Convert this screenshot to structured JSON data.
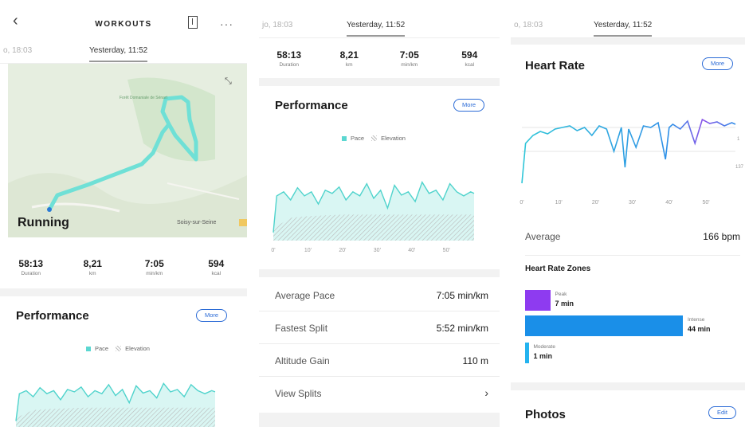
{
  "header": {
    "title": "WORKOUTS",
    "more_label": "···",
    "back_label": "‹"
  },
  "session_tabs": {
    "screen1": {
      "previous": "o, 18:03",
      "current": "Yesterday, 11:52"
    },
    "screen2": {
      "previous": "jo, 18:03",
      "current": "Yesterday, 11:52"
    },
    "screen3": {
      "previous": "o, 18:03",
      "current": "Yesterday, 11:52"
    }
  },
  "map": {
    "activity": "Running",
    "forest_label": "Forêt Domaniale de Sénart",
    "town_label": "Soisy-sur-Seine"
  },
  "stats": [
    {
      "value": "58:13",
      "label": "Duration"
    },
    {
      "value": "8,21",
      "label": "km"
    },
    {
      "value": "7:05",
      "label": "min/km"
    },
    {
      "value": "594",
      "label": "kcal"
    }
  ],
  "performance": {
    "title": "Performance",
    "more_label": "More",
    "legend": {
      "pace": "Pace",
      "elevation": "Elevation"
    }
  },
  "metrics": [
    {
      "label": "Average Pace",
      "value": "7:05 min/km"
    },
    {
      "label": "Fastest Split",
      "value": "5:52 min/km"
    },
    {
      "label": "Altitude Gain",
      "value": "110 m"
    }
  ],
  "view_splits": {
    "label": "View Splits",
    "chevron": "›"
  },
  "heart_rate": {
    "title": "Heart Rate",
    "more_label": "More",
    "right_tick_1": "1",
    "right_tick_2": "137",
    "average_label": "Average",
    "average_value": "166 bpm",
    "zones_title": "Heart Rate Zones",
    "zones": [
      {
        "name": "Peak",
        "value": "7 min",
        "minutes": 7,
        "color": "#8e3bf0"
      },
      {
        "name": "Intense",
        "value": "44 min",
        "minutes": 44,
        "color": "#1a8fe8"
      },
      {
        "name": "Moderate",
        "value": "1 min",
        "minutes": 1,
        "color": "#24b3ef"
      }
    ]
  },
  "photos": {
    "title": "Photos",
    "edit_label": "Edit"
  },
  "colors": {
    "accent": "#2b6bd6",
    "pace": "#5bd7d1",
    "hr_line": "#36c4d6",
    "peak": "#8e3bf0",
    "intense": "#1a8fe8"
  },
  "chart_data": [
    {
      "type": "area",
      "title": "Performance",
      "xlabel": "",
      "ylabel": "",
      "x_ticks": [
        "0'",
        "10'",
        "20'",
        "30'",
        "40'",
        "50'"
      ],
      "xlim": [
        0,
        58
      ],
      "series": [
        {
          "name": "Pace",
          "x": [
            0,
            1,
            3,
            5,
            7,
            9,
            11,
            13,
            15,
            17,
            19,
            21,
            23,
            25,
            27,
            29,
            31,
            33,
            35,
            37,
            39,
            41,
            43,
            45,
            47,
            49,
            51,
            53,
            55,
            57,
            58
          ],
          "values": [
            0.1,
            0.55,
            0.6,
            0.5,
            0.65,
            0.55,
            0.6,
            0.45,
            0.62,
            0.58,
            0.66,
            0.5,
            0.6,
            0.55,
            0.7,
            0.52,
            0.62,
            0.4,
            0.68,
            0.56,
            0.6,
            0.48,
            0.72,
            0.58,
            0.62,
            0.5,
            0.7,
            0.6,
            0.55,
            0.6,
            0.58
          ]
        },
        {
          "name": "Elevation",
          "x": [
            0,
            5,
            10,
            20,
            30,
            40,
            50,
            58
          ],
          "values": [
            0.15,
            0.28,
            0.3,
            0.32,
            0.32,
            0.32,
            0.32,
            0.32
          ]
        }
      ]
    },
    {
      "type": "line",
      "title": "Heart Rate",
      "xlabel": "",
      "ylabel": "",
      "x_ticks": [
        "0'",
        "10'",
        "20'",
        "30'",
        "40'",
        "50'"
      ],
      "xlim": [
        0,
        58
      ],
      "series": [
        {
          "name": "",
          "x": [
            0,
            1,
            3,
            5,
            7,
            9,
            11,
            13,
            15,
            17,
            19,
            21,
            23,
            25,
            27,
            28,
            29,
            31,
            33,
            35,
            37,
            39,
            40,
            41,
            43,
            45,
            47,
            49,
            51,
            53,
            55,
            57,
            58
          ],
          "values": [
            0.1,
            0.6,
            0.7,
            0.75,
            0.72,
            0.78,
            0.8,
            0.82,
            0.76,
            0.8,
            0.7,
            0.82,
            0.78,
            0.5,
            0.8,
            0.3,
            0.78,
            0.55,
            0.82,
            0.8,
            0.86,
            0.4,
            0.8,
            0.84,
            0.78,
            0.88,
            0.6,
            0.9,
            0.85,
            0.87,
            0.82,
            0.86,
            0.84
          ]
        }
      ]
    }
  ]
}
